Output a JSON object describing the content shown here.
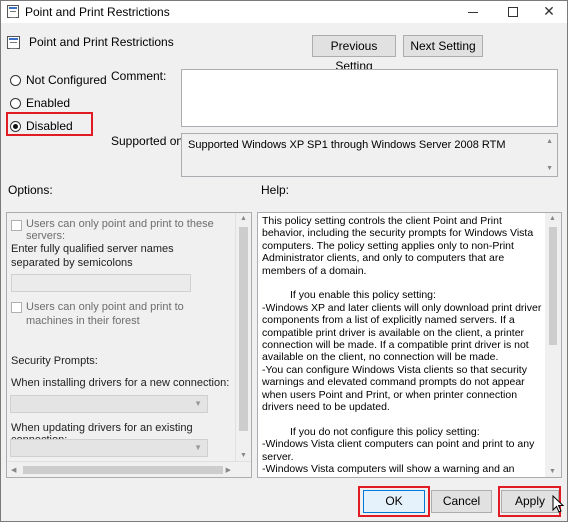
{
  "window": {
    "title": "Point and Print Restrictions"
  },
  "header": {
    "policy_name": "Point and Print Restrictions",
    "previous_label": "Previous Setting",
    "next_label": "Next Setting"
  },
  "state": {
    "options": [
      {
        "label": "Not Configured",
        "checked": false
      },
      {
        "label": "Enabled",
        "checked": false
      },
      {
        "label": "Disabled",
        "checked": true
      }
    ]
  },
  "comment": {
    "label": "Comment:",
    "value": ""
  },
  "supported": {
    "label": "Supported on:",
    "value": "Supported Windows XP SP1 through Windows Server 2008 RTM"
  },
  "options_pane": {
    "label": "Options:",
    "chk1": "Users can only point and print to these servers:",
    "server_prompt": "Enter fully qualified server names separated by semicolons",
    "server_input": "",
    "chk2": "Users can only point and print to machines in their forest",
    "security_prompts": "Security Prompts:",
    "new_conn_label": "When installing drivers for a new connection:",
    "existing_conn_label": "When updating drivers for an existing connection:"
  },
  "help_pane": {
    "label": "Help:",
    "p1": "This policy setting controls the client Point and Print behavior, including the security prompts for Windows Vista computers. The policy setting applies only to non-Print Administrator clients, and only to computers that are members of a domain.",
    "p2": "If you enable this policy setting:\n    -Windows XP and later clients will only download print driver components from a list of explicitly named servers. If a compatible print driver is available on the client, a printer connection will be made. If a compatible print driver is not available on the client, no connection will be made.\n    -You can configure Windows Vista clients so that security warnings and elevated command prompts do not appear when users Point and Print, or when printer connection drivers need to be updated.",
    "p3": "If you do not configure this policy setting:\n    -Windows Vista client computers can point and print to any server.\n    -Windows Vista computers will show a warning and an elevated command prompt when users create a printer connection to any server using Point and Print."
  },
  "footer": {
    "ok": "OK",
    "cancel": "Cancel",
    "apply": "Apply"
  }
}
